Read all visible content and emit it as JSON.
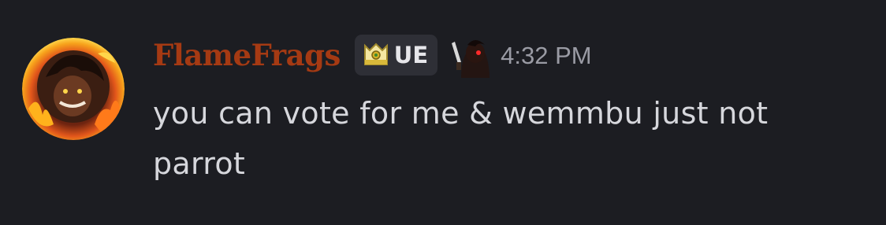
{
  "message": {
    "username": "FlameFrags",
    "username_color": "#a53a13",
    "clan_tag": {
      "icon": "guild-crown-badge-icon",
      "text": "UE"
    },
    "role_icon": "hooded-figure-knife-icon",
    "timestamp": "4:32 PM",
    "content": "you can vote for me & wemmbu just not parrot",
    "avatar_icon": "flame-character-avatar"
  },
  "colors": {
    "background": "#1c1d22",
    "tag_background": "#2e2f36",
    "text": "#d6d7dc",
    "timestamp": "#9a9ba4"
  }
}
